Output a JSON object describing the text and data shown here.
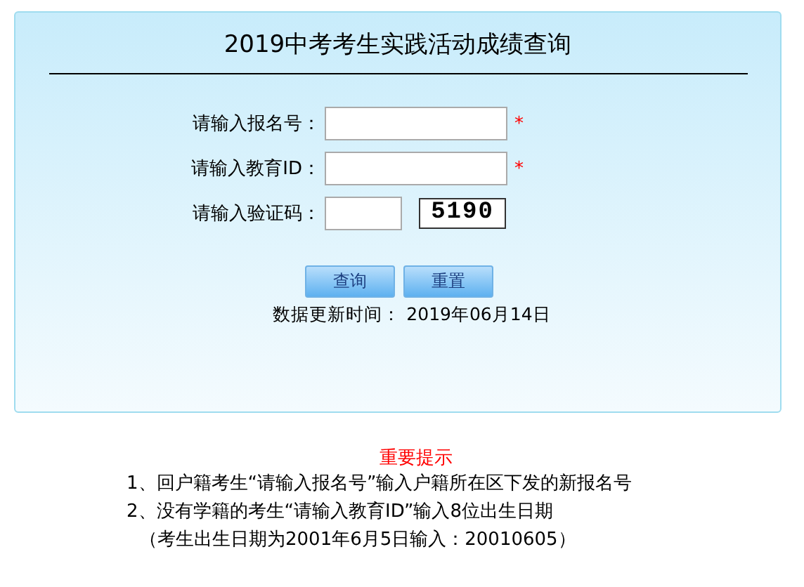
{
  "title": "2019中考考生实践活动成绩查询",
  "fields": [
    {
      "label": "请输入报名号：",
      "kind": "text",
      "required_mark": "*"
    },
    {
      "label": "请输入教育ID：",
      "kind": "text",
      "required_mark": "*"
    },
    {
      "label": "请输入验证码：",
      "kind": "captcha",
      "captcha": "5190"
    }
  ],
  "buttons": [
    "查询",
    "重置"
  ],
  "update_time": "数据更新时间： 2019年06月14日",
  "notice": {
    "heading": "重要提示",
    "lines": [
      "1、回户籍考生“请输入报名号”输入户籍所在区下发的新报名号",
      "2、没有学籍的考生“请输入教育ID”输入8位出生日期",
      "（考生出生日期为2001年6月5日输入：20010605）"
    ]
  }
}
